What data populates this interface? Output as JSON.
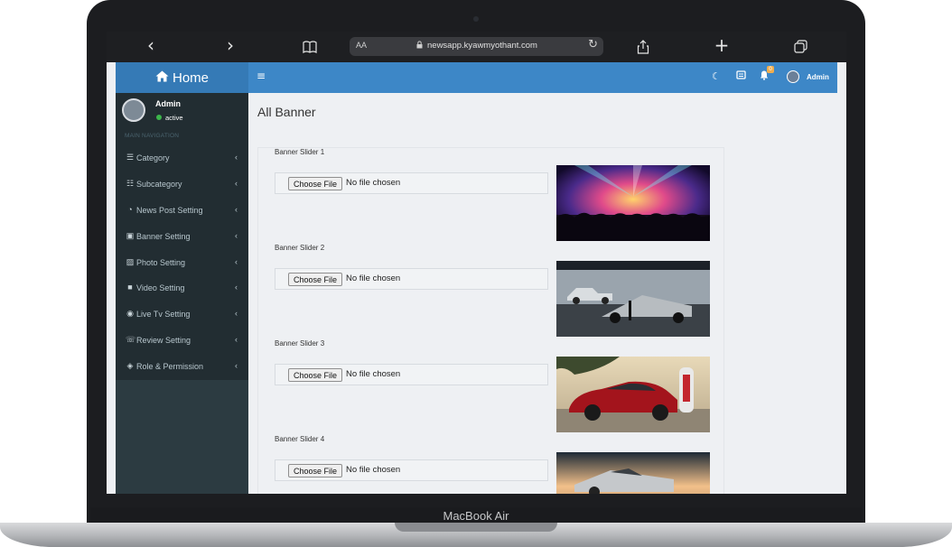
{
  "device": {
    "label": "MacBook Air"
  },
  "browser": {
    "back": "‹",
    "forward": "›",
    "text_size": "AA",
    "url": "newsapp.kyawmyothant.com",
    "share": "⇪",
    "new_tab": "+",
    "tabs": "⧉"
  },
  "header": {
    "brand": "Home",
    "menu_icon": "≡",
    "user": "Admin",
    "notification_count": "0"
  },
  "sidebar": {
    "user_name": "Admin",
    "status": "active",
    "section": "MAIN NAVIGATION",
    "items": [
      {
        "label": "Category",
        "icon": "list-icon"
      },
      {
        "label": "Subcategory",
        "icon": "list-ordered-icon"
      },
      {
        "label": "News Post Setting",
        "icon": "rss-icon"
      },
      {
        "label": "Banner Setting",
        "icon": "banner-icon"
      },
      {
        "label": "Photo Setting",
        "icon": "image-icon"
      },
      {
        "label": "Video Setting",
        "icon": "video-icon"
      },
      {
        "label": "Live Tv Setting",
        "icon": "record-icon"
      },
      {
        "label": "Review Setting",
        "icon": "comments-icon"
      },
      {
        "label": "Role & Permission",
        "icon": "shield-icon"
      }
    ]
  },
  "main": {
    "title": "All Banner",
    "banners": [
      {
        "label": "Banner Slider 1",
        "button": "Choose File",
        "file_status": "No file chosen",
        "image": "concert-crowd"
      },
      {
        "label": "Banner Slider 2",
        "button": "Choose File",
        "file_status": "No file chosen",
        "image": "cybertruck-stage"
      },
      {
        "label": "Banner Slider 3",
        "button": "Choose File",
        "file_status": "No file chosen",
        "image": "red-car-charger"
      },
      {
        "label": "Banner Slider 4",
        "button": "Choose File",
        "file_status": "No file chosen",
        "image": "cybertruck-desert"
      }
    ]
  },
  "colors": {
    "brand_bg": "#357ab6",
    "topbar_bg": "#3d87c7",
    "sidebar_bg": "#222d32",
    "status_green": "#3cb64b"
  }
}
